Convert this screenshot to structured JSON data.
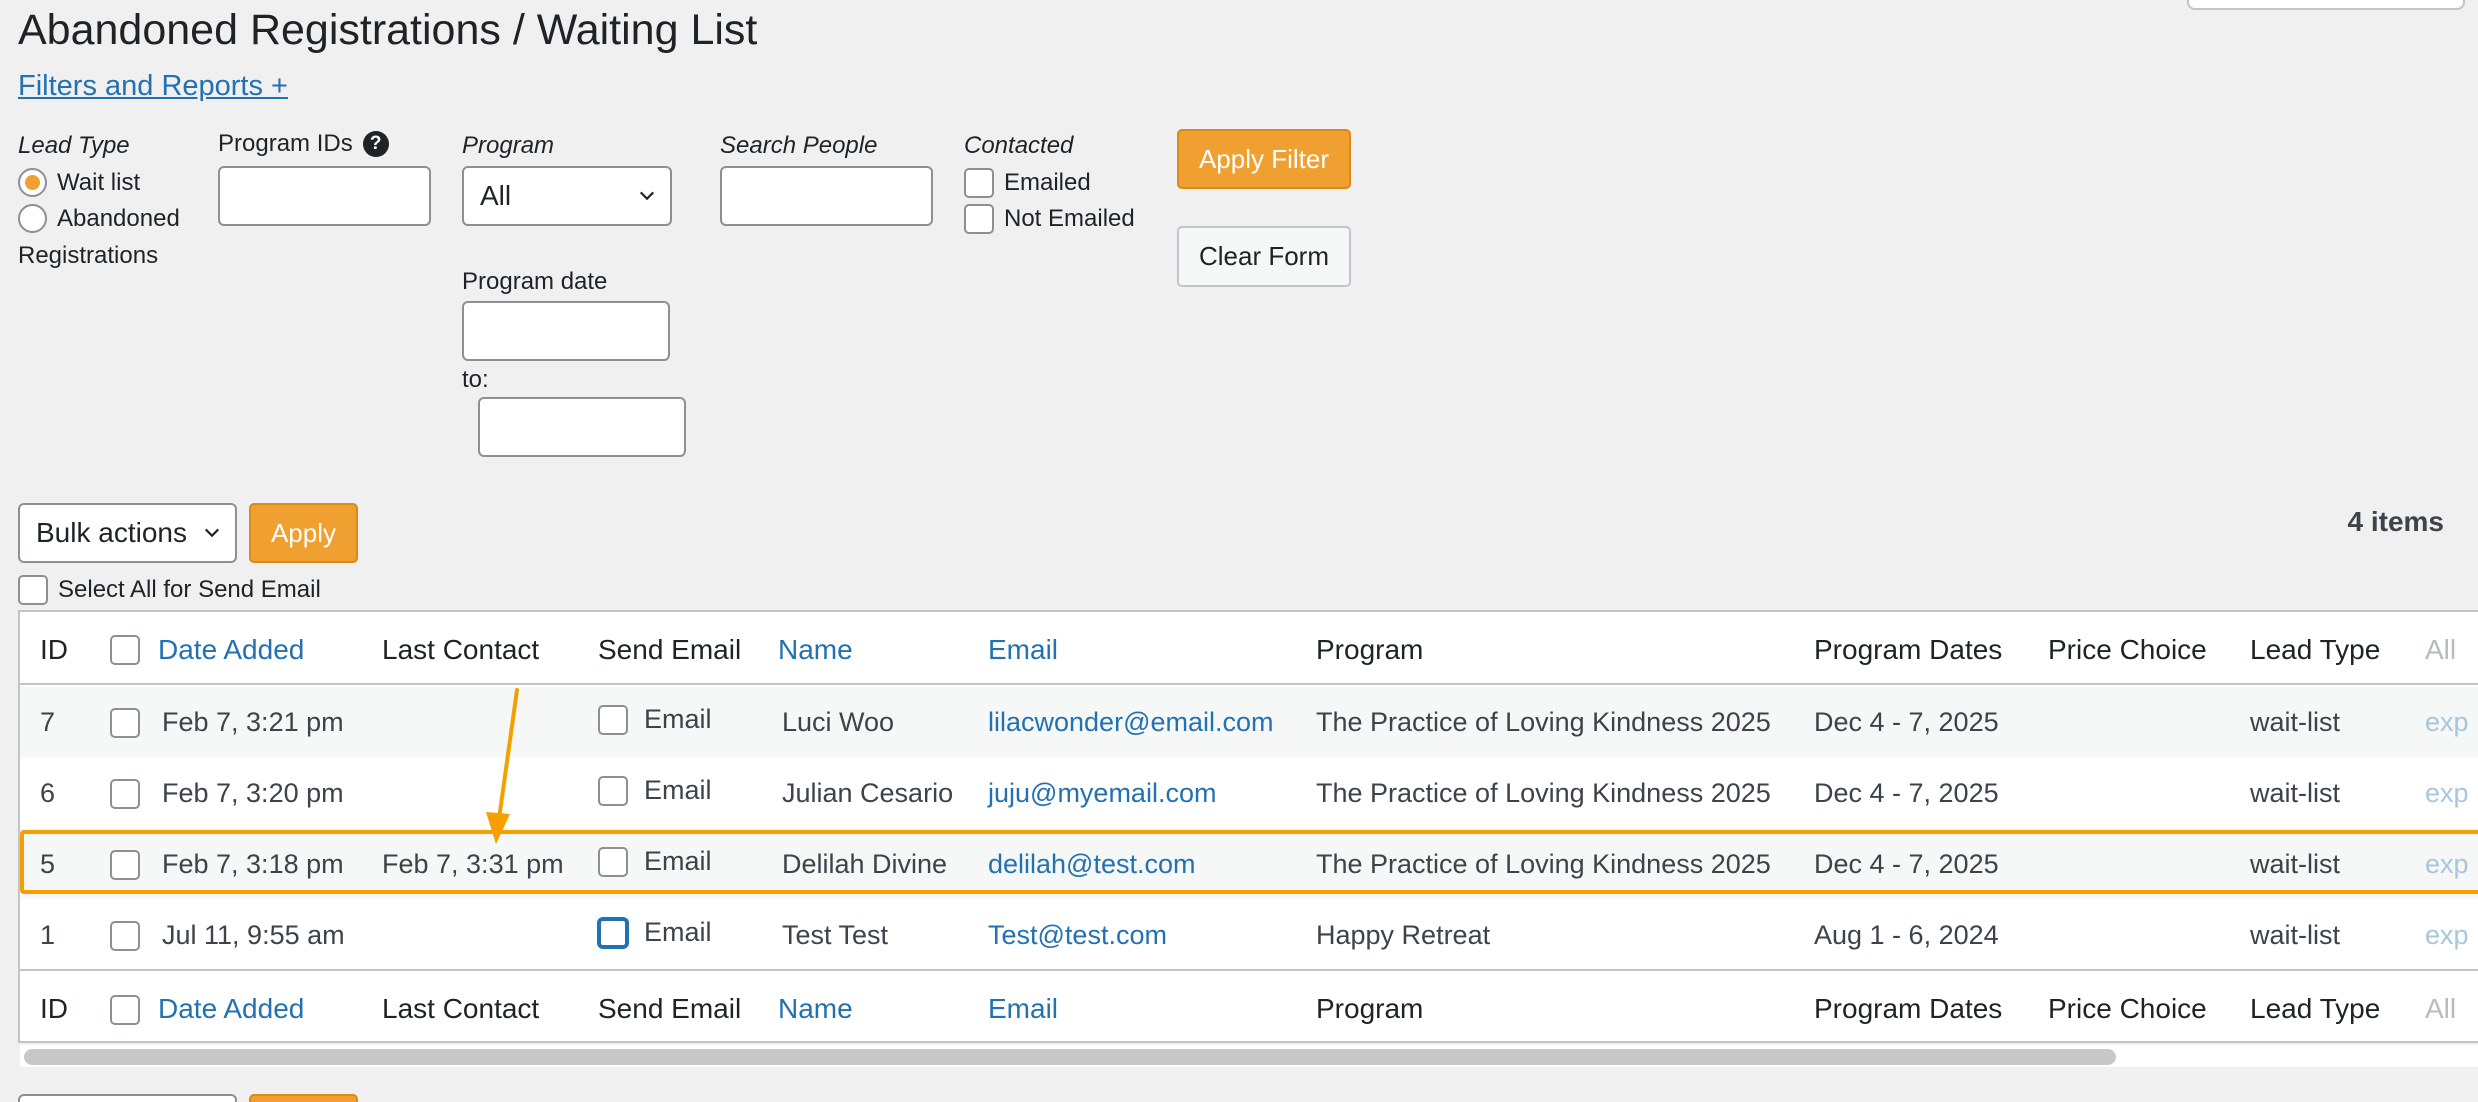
{
  "header": {
    "title": "Abandoned Registrations / Waiting List",
    "filters_link": "Filters and Reports +"
  },
  "filters": {
    "lead_type_label": "Lead Type",
    "lead_type_options": [
      {
        "label": "Wait list",
        "checked": true
      },
      {
        "label": "Abandoned",
        "checked": false
      }
    ],
    "lead_type_option2_line2": "Registrations",
    "program_ids_label": "Program IDs",
    "program_ids_value": "",
    "program_label": "Program",
    "program_selected": "All",
    "search_people_label": "Search People",
    "search_people_value": "",
    "contacted_label": "Contacted",
    "contacted_options": [
      {
        "label": "Emailed",
        "checked": false
      },
      {
        "label": "Not Emailed",
        "checked": false
      }
    ],
    "apply_filter_label": "Apply Filter",
    "clear_form_label": "Clear Form",
    "program_date_label": "Program date",
    "program_date_from": "",
    "to_label": "to:",
    "program_date_to": ""
  },
  "bulk": {
    "select_value": "Bulk actions",
    "apply_label": "Apply",
    "items_count": "4 items",
    "select_all_label": "Select All for Send Email"
  },
  "table": {
    "columns": {
      "id": "ID",
      "date_added": "Date Added",
      "last_contact": "Last Contact",
      "send_email": "Send Email",
      "name": "Name",
      "email": "Email",
      "program": "Program",
      "program_dates": "Program Dates",
      "price_choice": "Price Choice",
      "lead_type": "Lead Type",
      "all": "All"
    },
    "rows": [
      {
        "id": "7",
        "date_added": "Feb 7, 3:21 pm",
        "last_contact": "",
        "send_email": "Email",
        "name": "Luci Woo",
        "email": "lilacwonder@email.com",
        "program": "The Practice of Loving Kindness 2025",
        "program_dates": "Dec 4 - 7, 2025",
        "price_choice": "",
        "lead_type": "wait-list",
        "extra": "exp"
      },
      {
        "id": "6",
        "date_added": "Feb 7, 3:20 pm",
        "last_contact": "",
        "send_email": "Email",
        "name": "Julian Cesario",
        "email": "juju@myemail.com",
        "program": "The Practice of Loving Kindness 2025",
        "program_dates": "Dec 4 - 7, 2025",
        "price_choice": "",
        "lead_type": "wait-list",
        "extra": "exp"
      },
      {
        "id": "5",
        "date_added": "Feb 7, 3:18 pm",
        "last_contact": "Feb 7, 3:31 pm",
        "send_email": "Email",
        "name": "Delilah Divine",
        "email": "delilah@test.com",
        "program": "The Practice of Loving Kindness 2025",
        "program_dates": "Dec 4 - 7, 2025",
        "price_choice": "",
        "lead_type": "wait-list",
        "extra": "exp"
      },
      {
        "id": "1",
        "date_added": "Jul 11, 9:55 am",
        "last_contact": "",
        "send_email": "Email",
        "name": "Test Test",
        "email": "Test@test.com",
        "program": "Happy Retreat",
        "program_dates": "Aug 1 - 6, 2024",
        "price_choice": "",
        "lead_type": "wait-list",
        "extra": "exp"
      }
    ]
  },
  "colors": {
    "accent_orange": "#f0a030",
    "highlight": "#f5a000",
    "link_blue": "#2271b1"
  }
}
